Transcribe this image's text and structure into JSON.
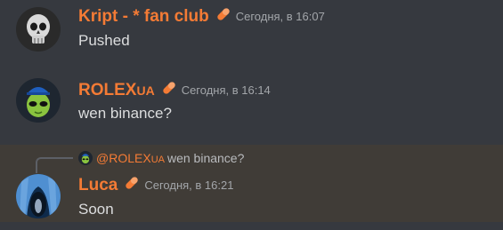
{
  "messages": [
    {
      "author": "Kript - * fan club",
      "author_suffix": "",
      "badge": "pill-icon",
      "timestamp": "Сегодня, в 16:07",
      "text": "Pushed",
      "avatar": "skull-avatar"
    },
    {
      "author": "ROLEX",
      "author_suffix": "UA",
      "badge": "pill-icon",
      "timestamp": "Сегодня, в 16:14",
      "text": "wen binance?",
      "avatar": "alien-avatar"
    },
    {
      "author": "Luca",
      "author_suffix": "",
      "badge": "pill-icon",
      "timestamp": "Сегодня, в 16:21",
      "text": "Soon",
      "avatar": "ice-cave-avatar",
      "reply": {
        "author": "@ROLEX",
        "author_suffix": "UA",
        "text": "wen binance?",
        "avatar": "alien-avatar"
      }
    }
  ],
  "colors": {
    "background": "#36393f",
    "highlight": "#403c37",
    "name": "#f47b35",
    "text": "#dcddde",
    "timestamp": "#a3a6aa"
  }
}
